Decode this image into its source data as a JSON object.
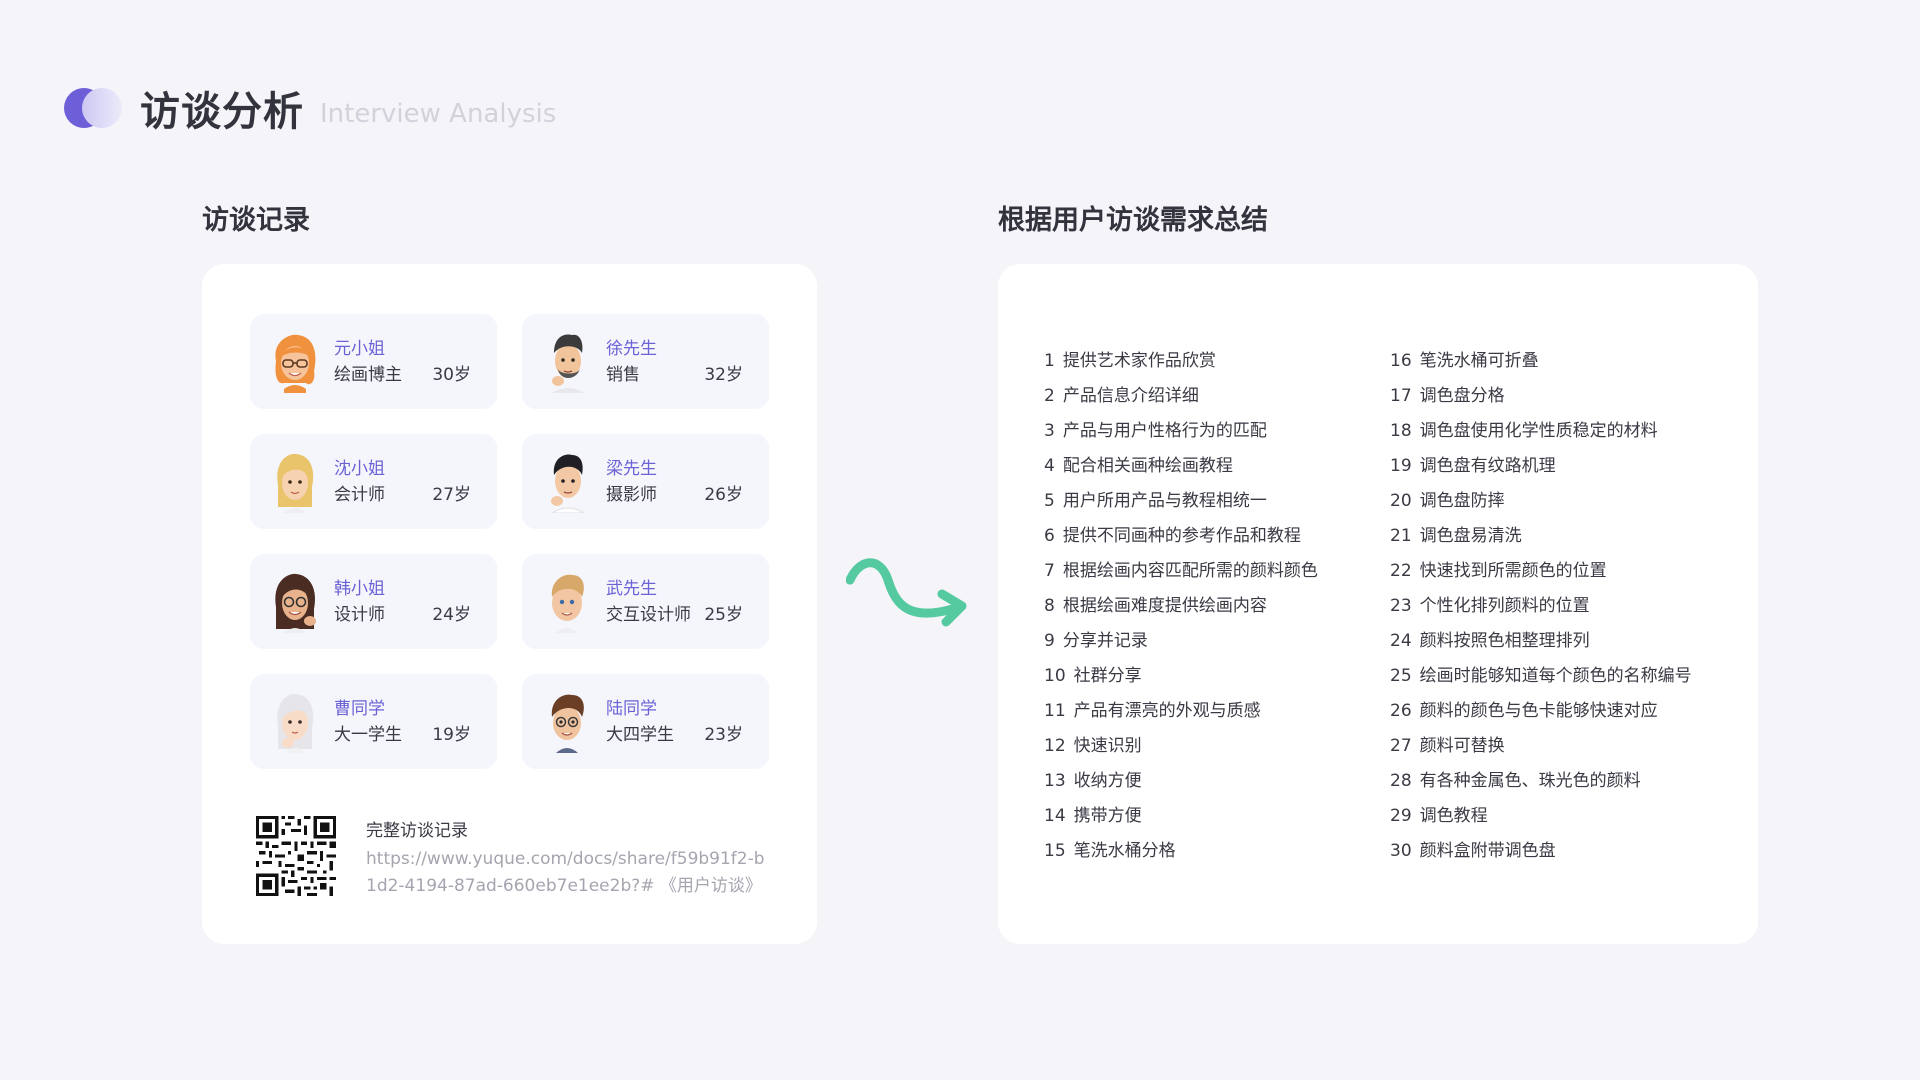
{
  "header": {
    "title": "访谈分析",
    "subtitle": "Interview Analysis"
  },
  "left_section": {
    "title": "访谈记录",
    "people": [
      {
        "name": "元小姐",
        "role": "绘画博主",
        "age": "30岁",
        "avatar": "memoji-woman-orange-hair-glasses"
      },
      {
        "name": "徐先生",
        "role": "销售",
        "age": "32岁",
        "avatar": "memoji-man-thinking-beard"
      },
      {
        "name": "沈小姐",
        "role": "会计师",
        "age": "27岁",
        "avatar": "memoji-woman-blonde"
      },
      {
        "name": "梁先生",
        "role": "摄影师",
        "age": "26岁",
        "avatar": "memoji-man-thinking-black-hair"
      },
      {
        "name": "韩小姐",
        "role": "设计师",
        "age": "24岁",
        "avatar": "memoji-woman-brown-hair-glasses"
      },
      {
        "name": "武先生",
        "role": "交互设计师",
        "age": "25岁",
        "avatar": "memoji-man-blonde"
      },
      {
        "name": "曹同学",
        "role": "大一学生",
        "age": "19岁",
        "avatar": "memoji-girl-white-hair"
      },
      {
        "name": "陆同学",
        "role": "大四学生",
        "age": "23岁",
        "avatar": "memoji-boy-brown-hair"
      }
    ],
    "record": {
      "title": "完整访谈记录",
      "link": "https://www.yuque.com/docs/share/f59b91f2-b1d2-4194-87ad-660eb7e1ee2b?# 《用户访谈》",
      "qr_icon": "qr-code-icon"
    }
  },
  "right_section": {
    "title": "根据用户访谈需求总结",
    "requirements_col1": [
      {
        "num": "1",
        "text": "提供艺术家作品欣赏"
      },
      {
        "num": "2",
        "text": "产品信息介绍详细"
      },
      {
        "num": "3",
        "text": "产品与用户性格行为的匹配"
      },
      {
        "num": "4",
        "text": "配合相关画种绘画教程"
      },
      {
        "num": "5",
        "text": "用户所用产品与教程相统一"
      },
      {
        "num": "6",
        "text": "提供不同画种的参考作品和教程"
      },
      {
        "num": "7",
        "text": "根据绘画内容匹配所需的颜料颜色"
      },
      {
        "num": "8",
        "text": "根据绘画难度提供绘画内容"
      },
      {
        "num": "9",
        "text": "分享并记录"
      },
      {
        "num": "10",
        "text": "社群分享"
      },
      {
        "num": "11",
        "text": "产品有漂亮的外观与质感"
      },
      {
        "num": "12",
        "text": "快速识别"
      },
      {
        "num": "13",
        "text": "收纳方便"
      },
      {
        "num": "14",
        "text": "携带方便"
      },
      {
        "num": "15",
        "text": "笔洗水桶分格"
      }
    ],
    "requirements_col2": [
      {
        "num": "16",
        "text": "笔洗水桶可折叠"
      },
      {
        "num": "17",
        "text": "调色盘分格"
      },
      {
        "num": "18",
        "text": "调色盘使用化学性质稳定的材料"
      },
      {
        "num": "19",
        "text": "调色盘有纹路机理"
      },
      {
        "num": "20",
        "text": "调色盘防摔"
      },
      {
        "num": "21",
        "text": "调色盘易清洗"
      },
      {
        "num": "22",
        "text": "快速找到所需颜色的位置"
      },
      {
        "num": "23",
        "text": "个性化排列颜料的位置"
      },
      {
        "num": "24",
        "text": "颜料按照色相整理排列"
      },
      {
        "num": "25",
        "text": "绘画时能够知道每个颜色的名称编号"
      },
      {
        "num": "26",
        "text": "颜料的颜色与色卡能够快速对应"
      },
      {
        "num": "27",
        "text": "颜料可替换"
      },
      {
        "num": "28",
        "text": "有各种金属色、珠光色的颜料"
      },
      {
        "num": "29",
        "text": "调色教程"
      },
      {
        "num": "30",
        "text": "颜料盒附带调色盘"
      }
    ]
  },
  "colors": {
    "accent": "#6c5fd8",
    "name_text": "#6b62d6",
    "arrow": "#55c9a0",
    "background": "#f4f4f9",
    "card": "#ffffff",
    "person_card": "#f5f6fb"
  },
  "icons": {
    "logo": "two-circles-logo-icon",
    "arrow": "curved-arrow-icon"
  }
}
